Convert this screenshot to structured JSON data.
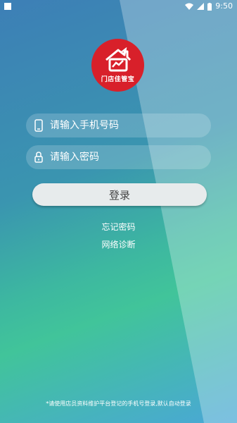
{
  "status_bar": {
    "time": "9:50"
  },
  "logo": {
    "text": "门店佳管宝"
  },
  "phone_field": {
    "placeholder": "请输入手机号码",
    "value": ""
  },
  "password_field": {
    "placeholder": "请输入密码",
    "value": ""
  },
  "login_button": {
    "label": "登录"
  },
  "links": {
    "forgot_password": "忘记密码",
    "network_diagnosis": "网络诊断"
  },
  "footer": {
    "note": "*请使用店员资料维护平台登记的手机号登录,默认自动登录"
  },
  "colors": {
    "logo_red": "#d8202a",
    "button_bg": "#e7ebec"
  }
}
